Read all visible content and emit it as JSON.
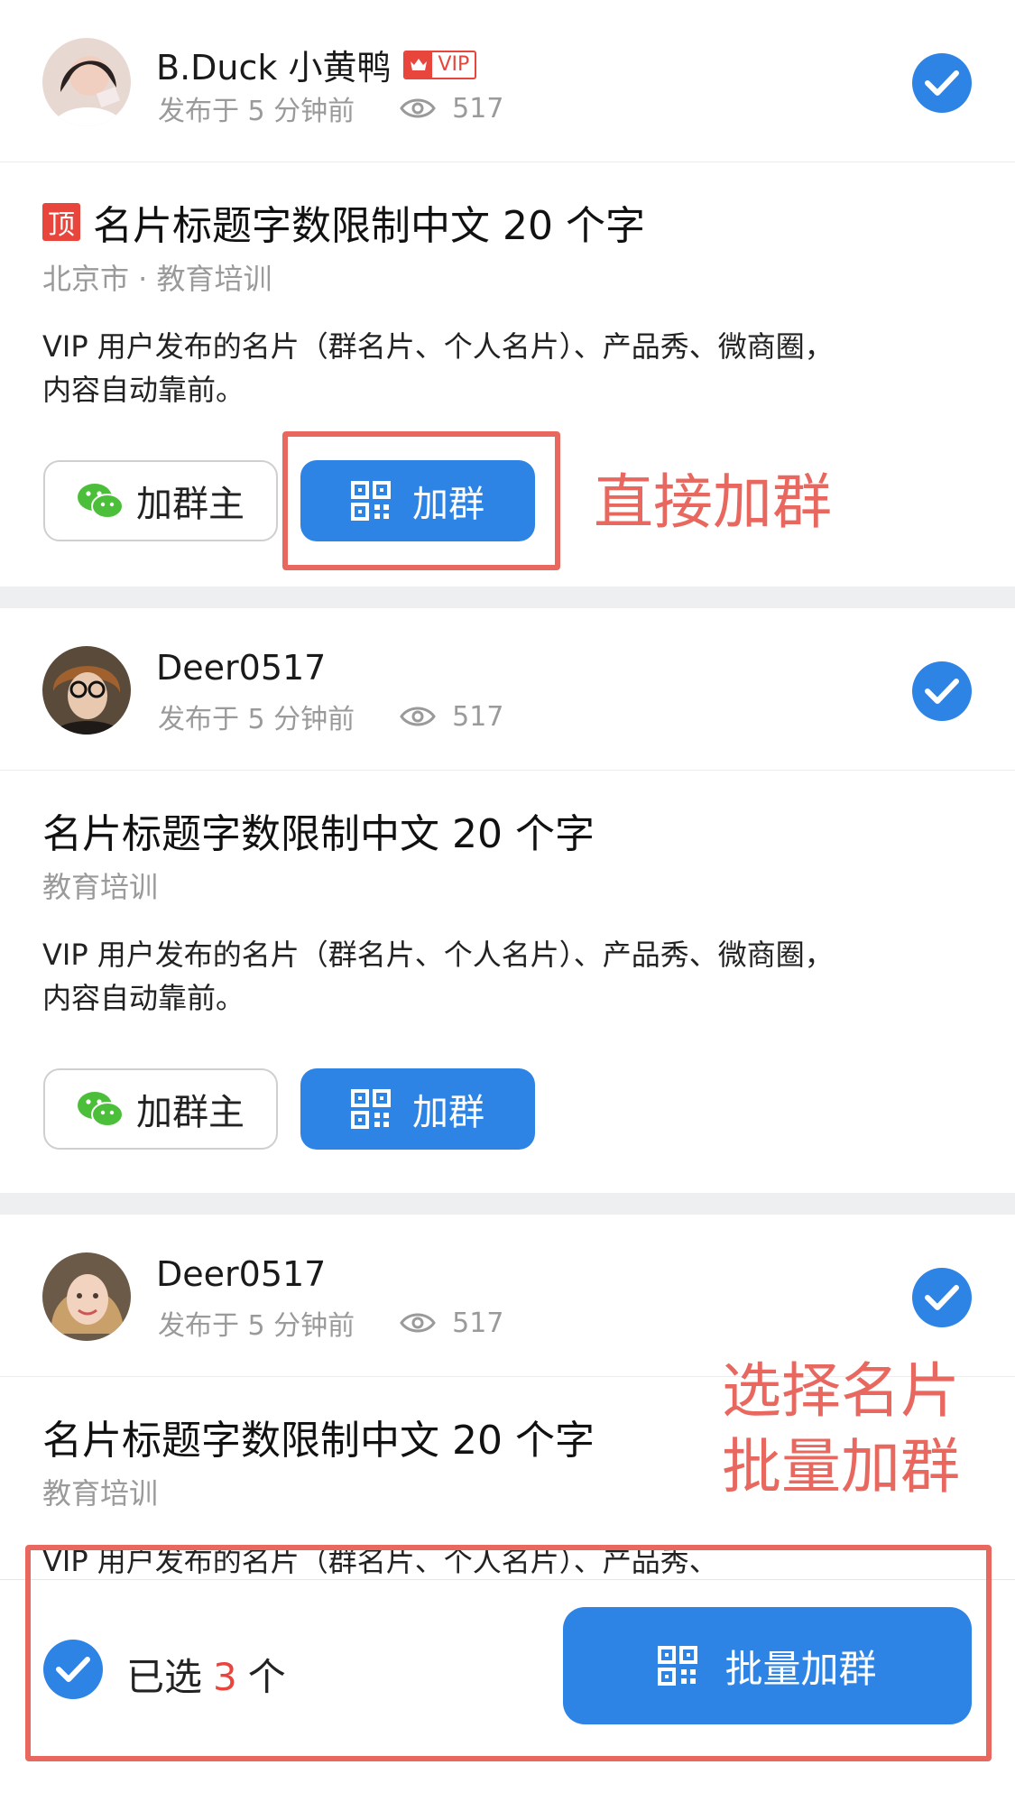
{
  "colors": {
    "accent": "#2d84e5",
    "annotation": "#e8675f",
    "vip": "#e8453c",
    "muted": "#9a9a9a",
    "separator": "#eeeff1"
  },
  "cards": [
    {
      "username": "B.Duck 小黄鸭",
      "vip_label": "VIP",
      "posted": "发布于 5 分钟前",
      "views": "517",
      "top_tag": "顶",
      "title": "名片标题字数限制中文 20 个字",
      "location": "北京市 · 教育培训",
      "desc": "VIP 用户发布的名片（群名片、个人名片）、产品秀、微商圈，内容自动靠前。",
      "add_owner": "加群主",
      "join": "加群",
      "selected": true
    },
    {
      "username": "Deer0517",
      "posted": "发布于 5 分钟前",
      "views": "517",
      "title": "名片标题字数限制中文 20 个字",
      "location": "教育培训",
      "desc": "VIP 用户发布的名片（群名片、个人名片）、产品秀、微商圈，内容自动靠前。",
      "add_owner": "加群主",
      "join": "加群",
      "selected": true
    },
    {
      "username": "Deer0517",
      "posted": "发布于 5 分钟前",
      "views": "517",
      "title": "名片标题字数限制中文 20 个字",
      "location": "教育培训",
      "desc": "VIP 用户发布的名片（群名片、个人名片）、产品秀、",
      "selected": true
    }
  ],
  "annotations": {
    "direct_join": "直接加群",
    "batch_line1": "选择名片",
    "batch_line2": "批量加群"
  },
  "bottom_bar": {
    "selected_prefix": "已选",
    "selected_count": "3",
    "selected_suffix": "个",
    "batch_button": "批量加群"
  }
}
